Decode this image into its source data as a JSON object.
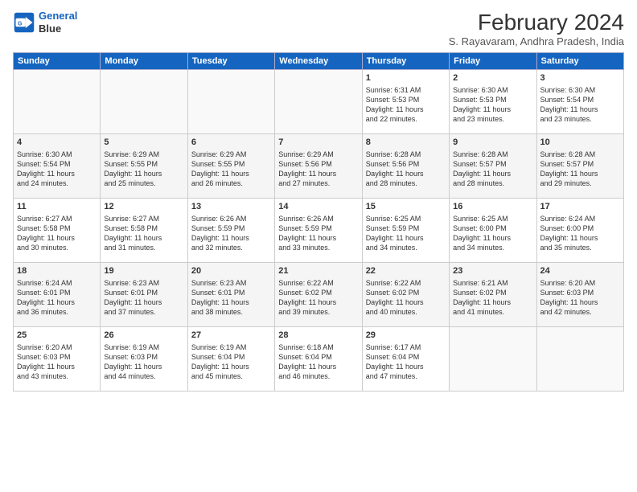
{
  "logo": {
    "line1": "General",
    "line2": "Blue"
  },
  "title": "February 2024",
  "subtitle": "S. Rayavaram, Andhra Pradesh, India",
  "days_of_week": [
    "Sunday",
    "Monday",
    "Tuesday",
    "Wednesday",
    "Thursday",
    "Friday",
    "Saturday"
  ],
  "weeks": [
    [
      {
        "day": "",
        "detail": ""
      },
      {
        "day": "",
        "detail": ""
      },
      {
        "day": "",
        "detail": ""
      },
      {
        "day": "",
        "detail": ""
      },
      {
        "day": "1",
        "detail": "Sunrise: 6:31 AM\nSunset: 5:53 PM\nDaylight: 11 hours\nand 22 minutes."
      },
      {
        "day": "2",
        "detail": "Sunrise: 6:30 AM\nSunset: 5:53 PM\nDaylight: 11 hours\nand 23 minutes."
      },
      {
        "day": "3",
        "detail": "Sunrise: 6:30 AM\nSunset: 5:54 PM\nDaylight: 11 hours\nand 23 minutes."
      }
    ],
    [
      {
        "day": "4",
        "detail": "Sunrise: 6:30 AM\nSunset: 5:54 PM\nDaylight: 11 hours\nand 24 minutes."
      },
      {
        "day": "5",
        "detail": "Sunrise: 6:29 AM\nSunset: 5:55 PM\nDaylight: 11 hours\nand 25 minutes."
      },
      {
        "day": "6",
        "detail": "Sunrise: 6:29 AM\nSunset: 5:55 PM\nDaylight: 11 hours\nand 26 minutes."
      },
      {
        "day": "7",
        "detail": "Sunrise: 6:29 AM\nSunset: 5:56 PM\nDaylight: 11 hours\nand 27 minutes."
      },
      {
        "day": "8",
        "detail": "Sunrise: 6:28 AM\nSunset: 5:56 PM\nDaylight: 11 hours\nand 28 minutes."
      },
      {
        "day": "9",
        "detail": "Sunrise: 6:28 AM\nSunset: 5:57 PM\nDaylight: 11 hours\nand 28 minutes."
      },
      {
        "day": "10",
        "detail": "Sunrise: 6:28 AM\nSunset: 5:57 PM\nDaylight: 11 hours\nand 29 minutes."
      }
    ],
    [
      {
        "day": "11",
        "detail": "Sunrise: 6:27 AM\nSunset: 5:58 PM\nDaylight: 11 hours\nand 30 minutes."
      },
      {
        "day": "12",
        "detail": "Sunrise: 6:27 AM\nSunset: 5:58 PM\nDaylight: 11 hours\nand 31 minutes."
      },
      {
        "day": "13",
        "detail": "Sunrise: 6:26 AM\nSunset: 5:59 PM\nDaylight: 11 hours\nand 32 minutes."
      },
      {
        "day": "14",
        "detail": "Sunrise: 6:26 AM\nSunset: 5:59 PM\nDaylight: 11 hours\nand 33 minutes."
      },
      {
        "day": "15",
        "detail": "Sunrise: 6:25 AM\nSunset: 5:59 PM\nDaylight: 11 hours\nand 34 minutes."
      },
      {
        "day": "16",
        "detail": "Sunrise: 6:25 AM\nSunset: 6:00 PM\nDaylight: 11 hours\nand 34 minutes."
      },
      {
        "day": "17",
        "detail": "Sunrise: 6:24 AM\nSunset: 6:00 PM\nDaylight: 11 hours\nand 35 minutes."
      }
    ],
    [
      {
        "day": "18",
        "detail": "Sunrise: 6:24 AM\nSunset: 6:01 PM\nDaylight: 11 hours\nand 36 minutes."
      },
      {
        "day": "19",
        "detail": "Sunrise: 6:23 AM\nSunset: 6:01 PM\nDaylight: 11 hours\nand 37 minutes."
      },
      {
        "day": "20",
        "detail": "Sunrise: 6:23 AM\nSunset: 6:01 PM\nDaylight: 11 hours\nand 38 minutes."
      },
      {
        "day": "21",
        "detail": "Sunrise: 6:22 AM\nSunset: 6:02 PM\nDaylight: 11 hours\nand 39 minutes."
      },
      {
        "day": "22",
        "detail": "Sunrise: 6:22 AM\nSunset: 6:02 PM\nDaylight: 11 hours\nand 40 minutes."
      },
      {
        "day": "23",
        "detail": "Sunrise: 6:21 AM\nSunset: 6:02 PM\nDaylight: 11 hours\nand 41 minutes."
      },
      {
        "day": "24",
        "detail": "Sunrise: 6:20 AM\nSunset: 6:03 PM\nDaylight: 11 hours\nand 42 minutes."
      }
    ],
    [
      {
        "day": "25",
        "detail": "Sunrise: 6:20 AM\nSunset: 6:03 PM\nDaylight: 11 hours\nand 43 minutes."
      },
      {
        "day": "26",
        "detail": "Sunrise: 6:19 AM\nSunset: 6:03 PM\nDaylight: 11 hours\nand 44 minutes."
      },
      {
        "day": "27",
        "detail": "Sunrise: 6:19 AM\nSunset: 6:04 PM\nDaylight: 11 hours\nand 45 minutes."
      },
      {
        "day": "28",
        "detail": "Sunrise: 6:18 AM\nSunset: 6:04 PM\nDaylight: 11 hours\nand 46 minutes."
      },
      {
        "day": "29",
        "detail": "Sunrise: 6:17 AM\nSunset: 6:04 PM\nDaylight: 11 hours\nand 47 minutes."
      },
      {
        "day": "",
        "detail": ""
      },
      {
        "day": "",
        "detail": ""
      }
    ]
  ]
}
